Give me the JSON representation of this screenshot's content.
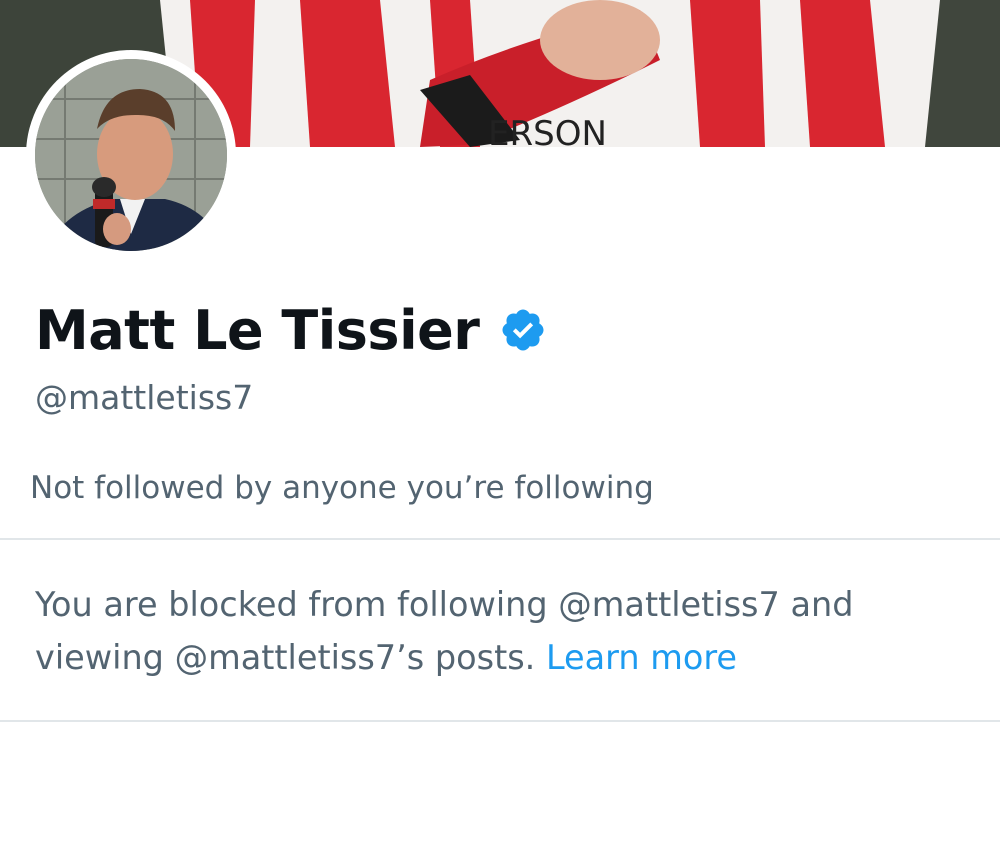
{
  "profile": {
    "display_name": "Matt Le Tissier",
    "handle": "@mattletiss7",
    "verified": true,
    "verified_icon": "verified-badge-icon",
    "followers_note": "Not followed by anyone you’re following"
  },
  "blocked_notice": {
    "text": "You are blocked from following @mattletiss7 and viewing @mattletiss7’s posts.",
    "link_label": "Learn more"
  },
  "banner": {
    "shirt_text": "ERSON"
  },
  "colors": {
    "primary_text": "#0f1419",
    "secondary_text": "#536471",
    "link": "#1d9bf0",
    "verified": "#1d9bf0",
    "divider": "#e1e6e9"
  }
}
